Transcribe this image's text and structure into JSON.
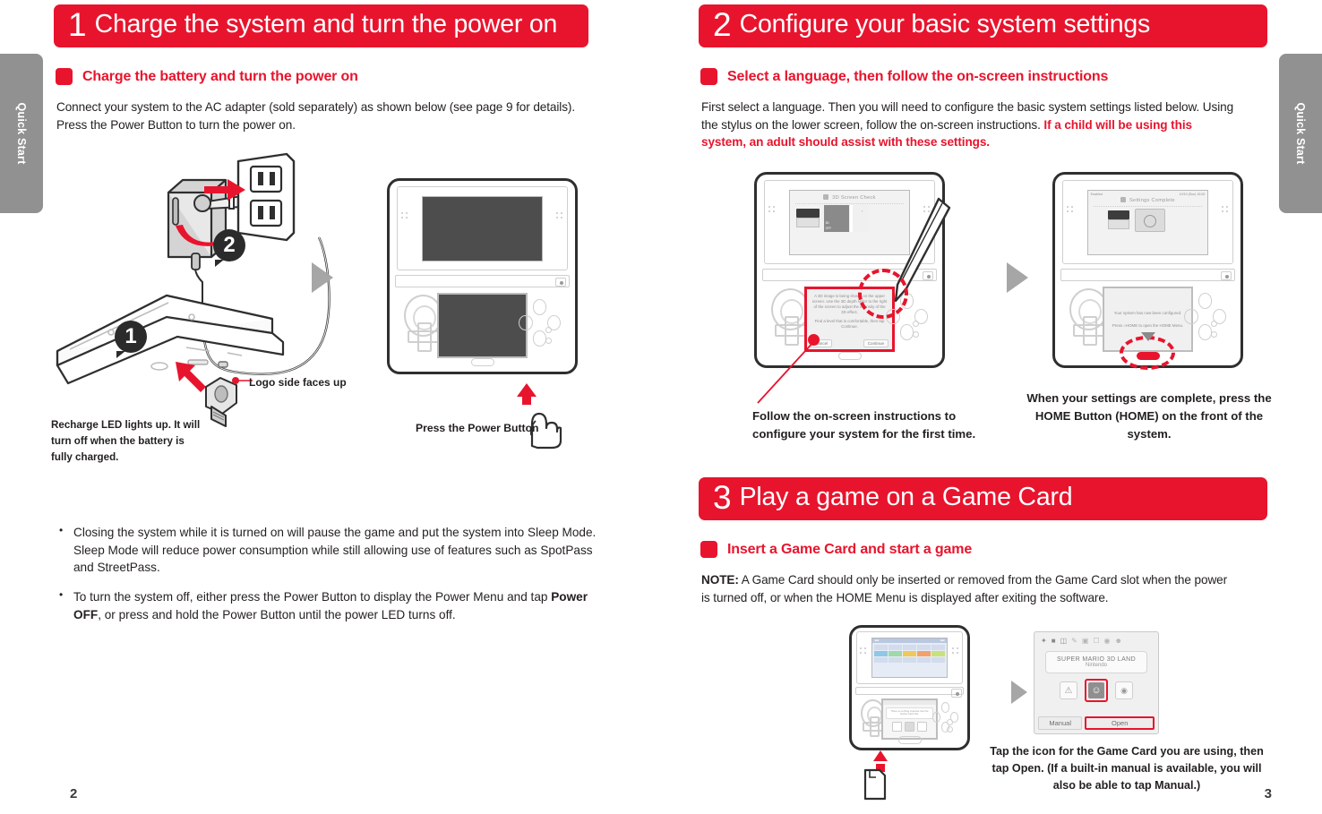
{
  "doc": {
    "side_tab_label": "Quick Start",
    "page_left_number": "2",
    "page_right_number": "3"
  },
  "left_page": {
    "step": {
      "number": "1",
      "title": "Charge the system and turn the power on"
    },
    "subhead": "Charge the battery and turn the power on",
    "intro": "Connect your system to the AC adapter (sold separately) as shown below (see page 9 for details). Press the Power Button to turn the power on.",
    "figure": {
      "badge_1": "1",
      "badge_2": "2",
      "logo_caption": "Logo side faces up",
      "led_caption": "Recharge LED lights up. It will turn off when the battery is fully charged.",
      "power_caption": "Press the Power Button"
    },
    "bullets": [
      "Closing the system while it is turned on will pause the game and put the system into Sleep Mode. Sleep Mode will reduce power consumption while still allowing use of features such as SpotPass and StreetPass.",
      "To turn the system off, either press the Power Button to display the Power Menu and tap Power OFF, or press and hold the Power Button until the power LED turns off."
    ],
    "bullet2_bold": "Power OFF"
  },
  "right_page": {
    "step2": {
      "number": "2",
      "title": "Configure your basic system settings"
    },
    "subhead2": "Select a language, then follow the on-screen instructions",
    "intro2_plain": "First select a language. Then you will need to configure the basic system settings listed below. Using the stylus on the lower screen, follow the on-screen instructions. ",
    "intro2_red": "If a child will be using this system, an adult should assist with these settings.",
    "fig2": {
      "screen_a_title": "3D Screen Check",
      "screen_a_label_3d": "3D",
      "screen_a_label_off": "OFF",
      "screen_a_body": "A 3D image is being shown on the upper screen. Use the 3D depth slider to the right of the screen to adjust the intensity of the 3D effect.",
      "screen_a_body2": "Find a level that is comfortable, then tap Continue.",
      "screen_a_btn_left": "Cancel",
      "screen_a_btn_right": "Continue",
      "screen_b_status_left": "Enabled",
      "screen_b_status_right": "10/10 (Sun) 16:00",
      "screen_b_title": "Settings Complete",
      "screen_b_body": "Your system has now been configured.",
      "screen_b_body2": "Press ⌂HOME to open the HOME Menu."
    },
    "caption_left": "Follow the on-screen instructions to configure your system for the first time.",
    "caption_right": "When your settings are complete, press the HOME Button (HOME) on the front of the system.",
    "step3": {
      "number": "3",
      "title": "Play a game on a Game Card"
    },
    "subhead3": "Insert a Game Card and start a game",
    "note_label": "NOTE:",
    "note_text": " A Game Card should only be inserted or removed from the Game Card slot when the power is turned off, or when the HOME Menu is displayed after exiting the software.",
    "fig3": {
      "home_menu_hint": "There is nothing inserted into the Game Card slot.",
      "card_title": "SUPER MARIO 3D LAND",
      "card_publisher": "Nintendo",
      "btn_manual": "Manual",
      "btn_open": "Open"
    },
    "caption_bottom_1": "Tap the icon for the Game Card you are using, then",
    "caption_bottom_2a": "tap ",
    "caption_bottom_2b": "Open",
    "caption_bottom_2c": ". (If a built-in manual is available, you will",
    "caption_bottom_3a": "also be able to tap ",
    "caption_bottom_3b": "Manual",
    "caption_bottom_3c": ".)"
  },
  "colors": {
    "brand_red": "#e8142d",
    "tab_grey": "#919191",
    "ink": "#231f20",
    "screen_grey": "#4d4d4d"
  }
}
